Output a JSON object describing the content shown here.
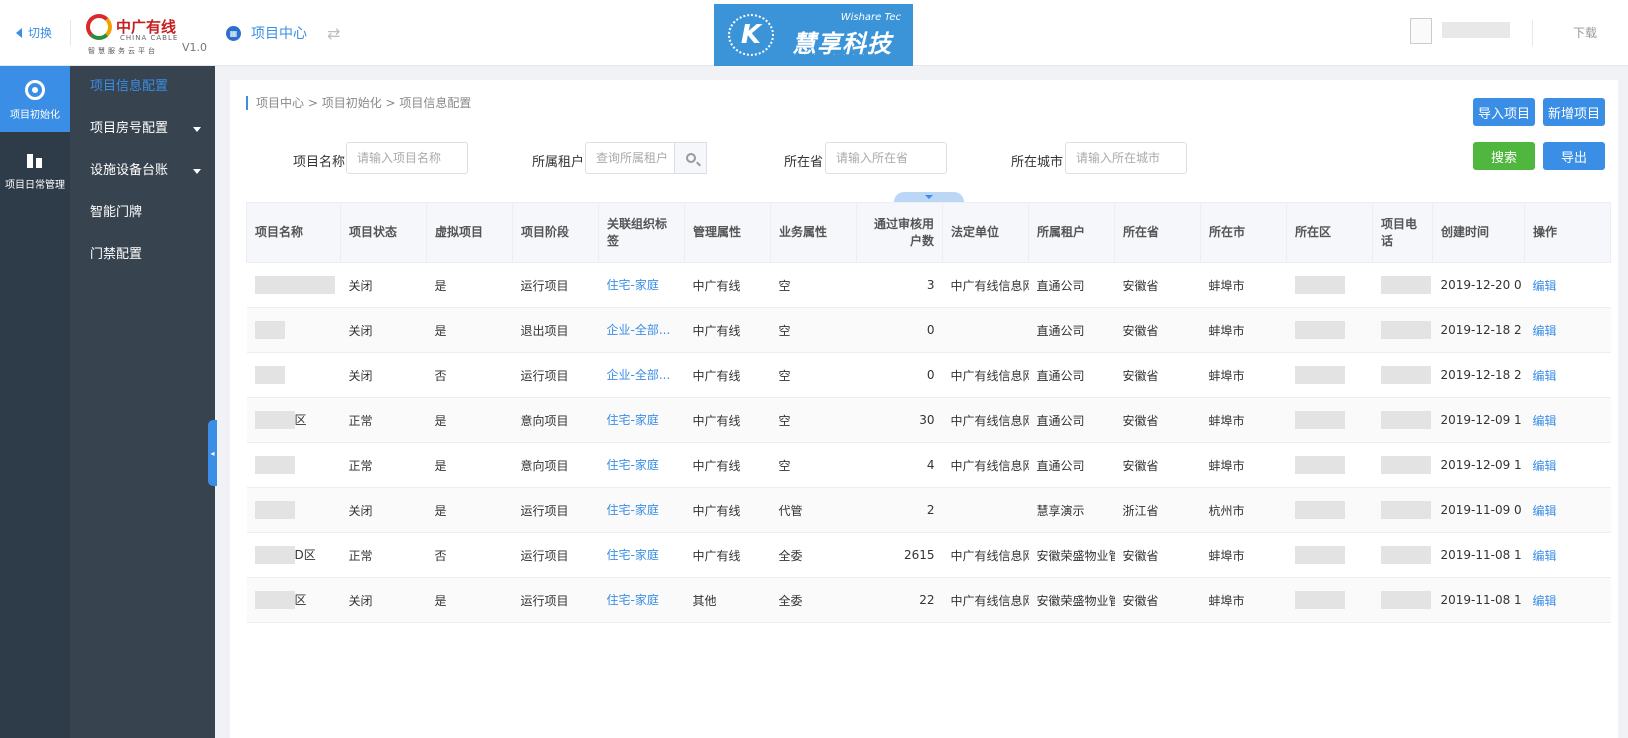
{
  "header": {
    "switch_label": "切换",
    "logo": {
      "main": "中广有线",
      "sub": "CHINA CABLE",
      "tagline": "智慧服务云平台",
      "version": "V1.0"
    },
    "project_center": "项目中心",
    "project_center_icon": "grid-icon",
    "brand": {
      "en": "Wishare Tec",
      "cn": "慧享科技",
      "mark": "K"
    },
    "download": "下载"
  },
  "rail": [
    {
      "label": "项目初始化",
      "icon": "target-icon",
      "active": true
    },
    {
      "label": "项目日常管理",
      "icon": "building-icon",
      "active": false
    }
  ],
  "submenu": [
    {
      "label": "项目信息配置",
      "active": true,
      "expandable": false
    },
    {
      "label": "项目房号配置",
      "active": false,
      "expandable": true
    },
    {
      "label": "设施设备台账",
      "active": false,
      "expandable": true
    },
    {
      "label": "智能门牌",
      "active": false,
      "expandable": false
    },
    {
      "label": "门禁配置",
      "active": false,
      "expandable": false
    }
  ],
  "breadcrumb": [
    "项目中心",
    "项目初始化",
    "项目信息配置"
  ],
  "actions": {
    "import": "导入项目",
    "add": "新增项目",
    "search": "搜索",
    "export": "导出"
  },
  "filters": {
    "name": {
      "label": "项目名称",
      "placeholder": "请输入项目名称"
    },
    "tenant": {
      "label": "所属租户",
      "placeholder": "查询所属租户"
    },
    "province": {
      "label": "所在省",
      "placeholder": "请输入所在省"
    },
    "city": {
      "label": "所在城市",
      "placeholder": "请输入所在城市"
    }
  },
  "table": {
    "headers": [
      "项目名称",
      "项目状态",
      "虚拟项目",
      "项目阶段",
      "关联组织标签",
      "管理属性",
      "业务属性",
      "通过审核用户数",
      "法定单位",
      "所属租户",
      "所在省",
      "所在市",
      "所在区",
      "项目电话",
      "创建时间",
      "操作"
    ],
    "rows": [
      {
        "name": "",
        "status": "关闭",
        "virtual": "是",
        "stage": "运行项目",
        "tag": "住宅-家庭",
        "mgmt": "中广有线",
        "biz": "空",
        "users": "3",
        "legal": "中广有线信息网",
        "tenant": "直通公司",
        "province": "安徽省",
        "city": "蚌埠市",
        "created": "2019-12-20 0",
        "op": "编辑"
      },
      {
        "name": "",
        "status": "关闭",
        "virtual": "是",
        "stage": "退出项目",
        "tag": "企业-全部...",
        "mgmt": "中广有线",
        "biz": "空",
        "users": "0",
        "legal": "",
        "tenant": "直通公司",
        "province": "安徽省",
        "city": "蚌埠市",
        "created": "2019-12-18 2",
        "op": "编辑"
      },
      {
        "name": "",
        "status": "关闭",
        "virtual": "否",
        "stage": "运行项目",
        "tag": "企业-全部...",
        "mgmt": "中广有线",
        "biz": "空",
        "users": "0",
        "legal": "中广有线信息网",
        "tenant": "直通公司",
        "province": "安徽省",
        "city": "蚌埠市",
        "created": "2019-12-18 2",
        "op": "编辑"
      },
      {
        "name": "区",
        "status": "正常",
        "virtual": "是",
        "stage": "意向项目",
        "tag": "住宅-家庭",
        "mgmt": "中广有线",
        "biz": "空",
        "users": "30",
        "legal": "中广有线信息网",
        "tenant": "直通公司",
        "province": "安徽省",
        "city": "蚌埠市",
        "created": "2019-12-09 1",
        "op": "编辑"
      },
      {
        "name": "",
        "status": "正常",
        "virtual": "是",
        "stage": "意向项目",
        "tag": "住宅-家庭",
        "mgmt": "中广有线",
        "biz": "空",
        "users": "4",
        "legal": "中广有线信息网",
        "tenant": "直通公司",
        "province": "安徽省",
        "city": "蚌埠市",
        "created": "2019-12-09 1",
        "op": "编辑"
      },
      {
        "name": "",
        "status": "关闭",
        "virtual": "是",
        "stage": "运行项目",
        "tag": "住宅-家庭",
        "mgmt": "中广有线",
        "biz": "代管",
        "users": "2",
        "legal": "",
        "tenant": "慧享演示",
        "province": "浙江省",
        "city": "杭州市",
        "created": "2019-11-09 0",
        "op": "编辑"
      },
      {
        "name": "D区",
        "status": "正常",
        "virtual": "否",
        "stage": "运行项目",
        "tag": "住宅-家庭",
        "mgmt": "中广有线",
        "biz": "全委",
        "users": "2615",
        "legal": "中广有线信息网",
        "tenant": "安徽荣盛物业管",
        "province": "安徽省",
        "city": "蚌埠市",
        "created": "2019-11-08 1",
        "op": "编辑"
      },
      {
        "name": "区",
        "status": "关闭",
        "virtual": "是",
        "stage": "运行项目",
        "tag": "住宅-家庭",
        "mgmt": "其他",
        "biz": "全委",
        "users": "22",
        "legal": "中广有线信息网",
        "tenant": "安徽荣盛物业管",
        "province": "安徽省",
        "city": "蚌埠市",
        "created": "2019-11-08 1",
        "op": "编辑"
      }
    ]
  }
}
